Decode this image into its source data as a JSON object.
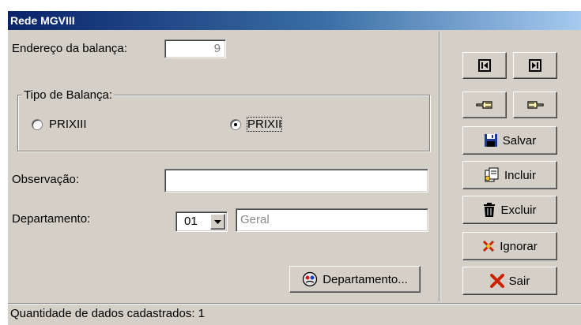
{
  "window": {
    "title": "Rede MGVIII"
  },
  "form": {
    "endereco_label": "Endereço da balança:",
    "endereco_value": "9",
    "tipo_group_label": "Tipo de Balança:",
    "radio_options": [
      {
        "label": "PRIXIII",
        "selected": false
      },
      {
        "label": "PRIXII",
        "selected": true
      }
    ],
    "observacao_label": "Observação:",
    "observacao_value": "",
    "departamento_label": "Departamento:",
    "departamento_code": "01",
    "departamento_name": "Geral",
    "departamento_button": "Departamento..."
  },
  "toolbar": {
    "salvar": "Salvar",
    "incluir": "Incluir",
    "excluir": "Excluir",
    "ignorar": "Ignorar",
    "sair": "Sair"
  },
  "status": {
    "text": "Quantidade de dados cadastrados: 1"
  },
  "colors": {
    "title_start": "#0a246a",
    "title_end": "#a6caf0",
    "face": "#d4d0c8",
    "cancel_red": "#cc2200"
  }
}
